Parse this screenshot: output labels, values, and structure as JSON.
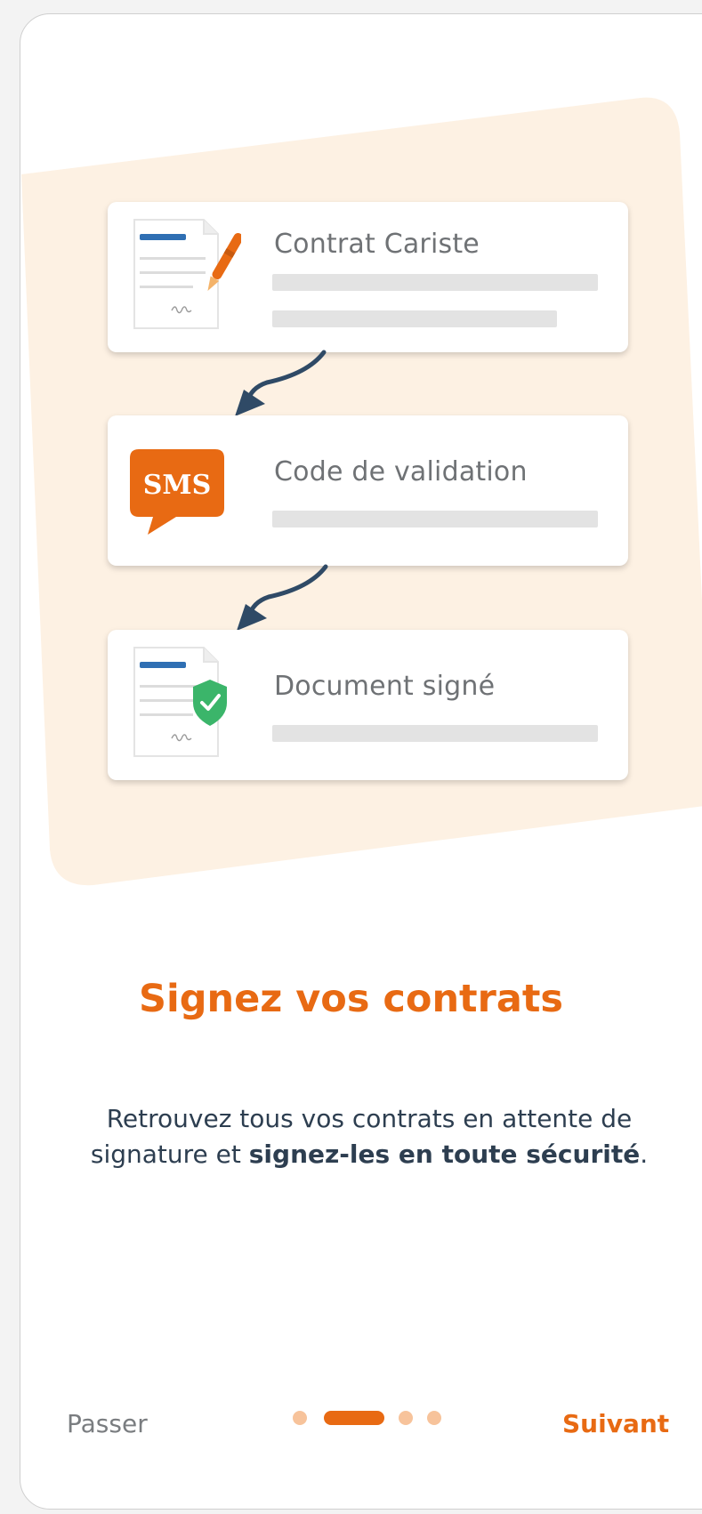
{
  "colors": {
    "accent": "#e86a13",
    "accent_light": "#f7c39b",
    "illustration_bg": "#fdf1e3",
    "text_dark": "#2d3e50",
    "text_muted": "#7a7d80",
    "navy": "#2f4a66",
    "check_green": "#3bb56a"
  },
  "cards": [
    {
      "title": "Contrat Cariste",
      "icon": "signing-document-icon",
      "placeholder_lines": 2
    },
    {
      "title": "Code de validation",
      "icon": "sms-bubble-icon",
      "icon_text": "SMS",
      "placeholder_lines": 1
    },
    {
      "title": "Document signé",
      "icon": "signed-document-check-icon",
      "placeholder_lines": 1
    }
  ],
  "heading": "Signez vos contrats",
  "description": {
    "part1": "Retrouvez tous vos contrats en attente de signature et ",
    "bold": "signez-les en toute sécurité",
    "part2": "."
  },
  "footer": {
    "skip_label": "Passer",
    "next_label": "Suivant",
    "pagination": {
      "total": 4,
      "active_index": 1
    }
  }
}
